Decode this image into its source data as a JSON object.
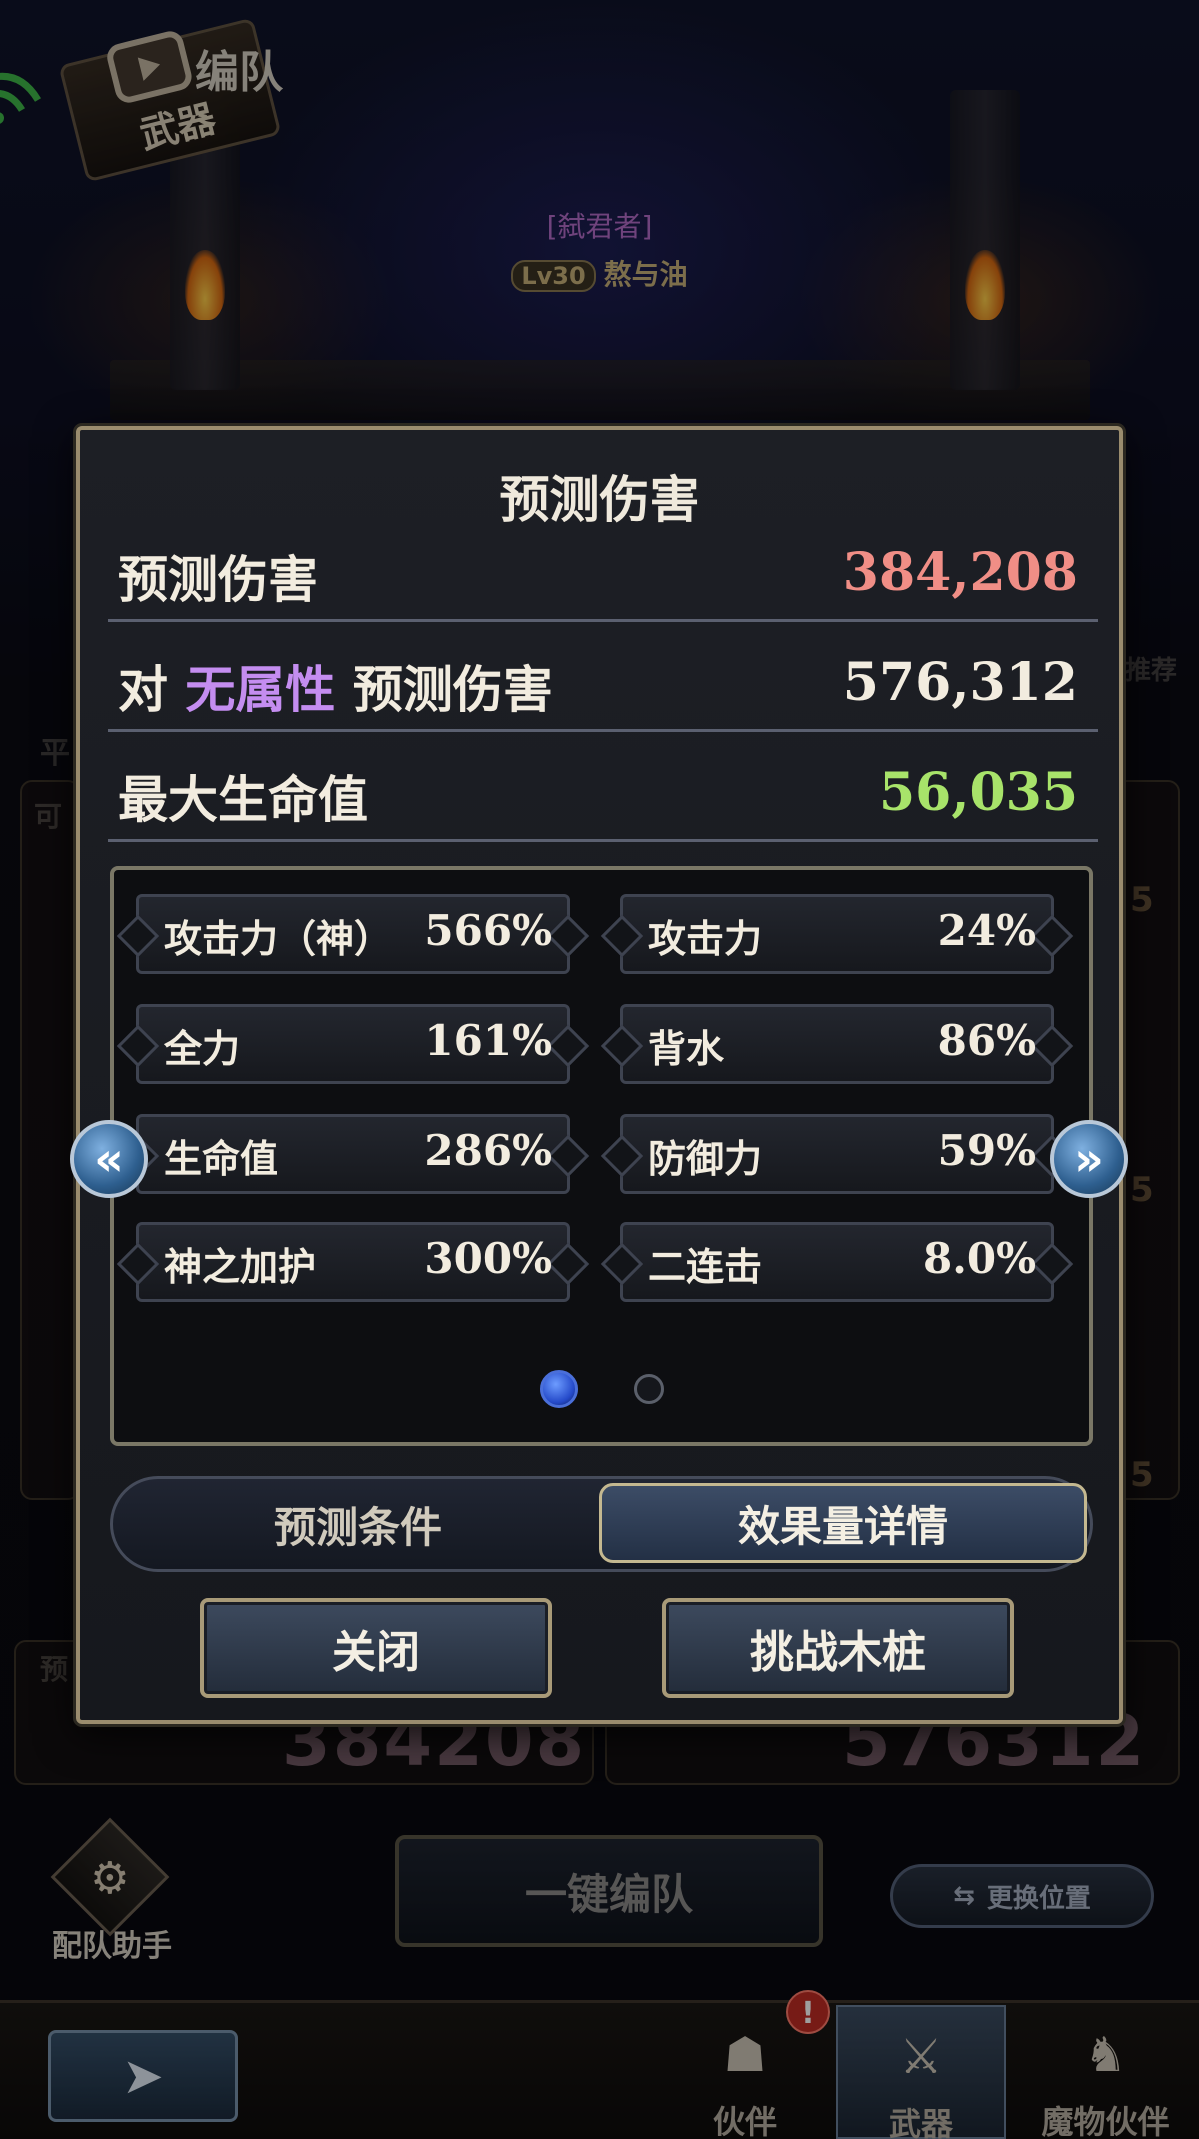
{
  "header": {
    "badge_label": "武器",
    "page_title": "编队",
    "title_tag": "[弑君者]",
    "level": "Lv30",
    "character_name": "熬与油"
  },
  "background": {
    "left_labels": [
      "平",
      "可",
      "预"
    ],
    "right_label": "推荐",
    "slot_numbers": [
      "5",
      "5",
      "5"
    ],
    "faded_damage_values": [
      "384208",
      "576312"
    ]
  },
  "modal": {
    "title": "预测伤害",
    "rows": [
      {
        "label": "预测伤害",
        "value": "384,208",
        "color": "#f08e86"
      },
      {
        "label_prefix": "对",
        "label_accent": "无属性",
        "label_suffix": "预测伤害",
        "value": "576,312",
        "color": "#f2ecdf"
      },
      {
        "label": "最大生命值",
        "value": "56,035",
        "color": "#a8e36a"
      }
    ],
    "effects": [
      {
        "name": "攻击力（神）",
        "value": "566%"
      },
      {
        "name": "攻击力",
        "value": "24%"
      },
      {
        "name": "全力",
        "value": "161%"
      },
      {
        "name": "背水",
        "value": "86%"
      },
      {
        "name": "生命值",
        "value": "286%"
      },
      {
        "name": "防御力",
        "value": "59%"
      },
      {
        "name": "神之加护",
        "value": "300%"
      },
      {
        "name": "二连击",
        "value": "8.0%"
      }
    ],
    "page_indicator": {
      "current": 1,
      "total": 2
    },
    "prev_arrow": "«",
    "next_arrow": "»",
    "toggle": {
      "conditions": "预测条件",
      "details": "效果量详情",
      "selected": "details"
    },
    "close_button": "关闭",
    "challenge_button": "挑战木桩"
  },
  "bottom": {
    "helper_label": "配队助手",
    "auto_team_button": "一键编队",
    "swap_button": "更换位置",
    "tabs": [
      {
        "label": "伙伴",
        "icon": "partner-icon",
        "alert": "!"
      },
      {
        "label": "武器",
        "icon": "weapon-icon",
        "active": true
      },
      {
        "label": "魔物伙伴",
        "icon": "monster-icon"
      }
    ]
  },
  "colors": {
    "accent_purple": "#c48df0",
    "damage_red": "#f08e86",
    "hp_green": "#a8e36a",
    "frame_gold": "#9a8c6e"
  }
}
